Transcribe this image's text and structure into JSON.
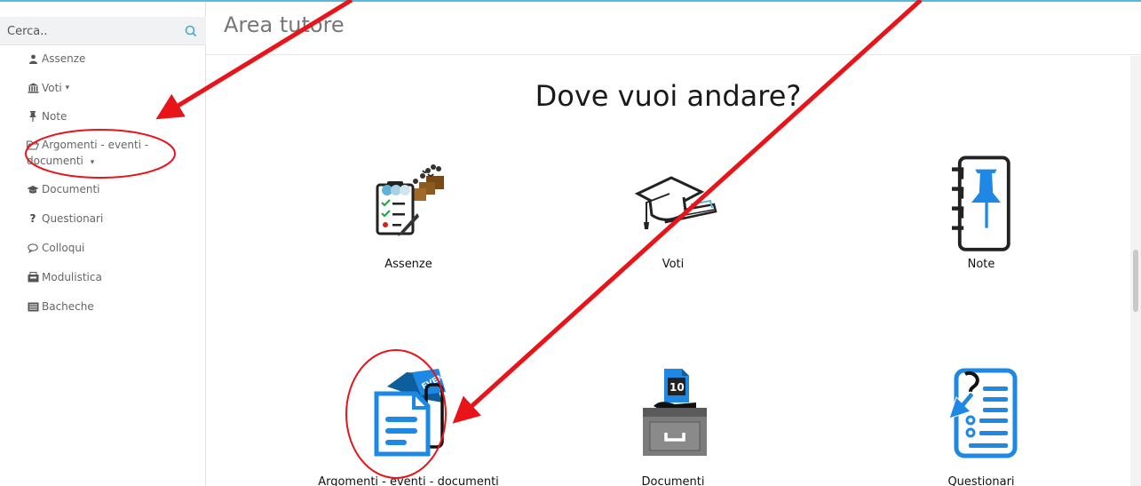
{
  "search": {
    "placeholder": "Cerca.."
  },
  "sidebar": {
    "items": [
      {
        "label": "Assenze",
        "icon": "user-icon"
      },
      {
        "label": "Voti",
        "icon": "bank-icon",
        "caret": "▾"
      },
      {
        "label": "Note",
        "icon": "pin-icon"
      },
      {
        "label": "Argomenti - eventi - documenti",
        "icon": "folder-open-icon",
        "caret": "▾"
      },
      {
        "label": "Documenti",
        "icon": "graduation-cap-icon"
      },
      {
        "label": "Questionari",
        "icon": "question-icon"
      },
      {
        "label": "Colloqui",
        "icon": "chat-icon"
      },
      {
        "label": "Modulistica",
        "icon": "document-stack-icon"
      },
      {
        "label": "Bacheche",
        "icon": "board-icon"
      }
    ]
  },
  "header": {
    "title": "Area tutore"
  },
  "main": {
    "question": "Dove vuoi andare?",
    "tiles": [
      {
        "label": "Assenze",
        "icon": "attendance-clipboard-icon"
      },
      {
        "label": "Voti",
        "icon": "graduation-cap-diploma-icon"
      },
      {
        "label": "Note",
        "icon": "notebook-pin-icon"
      },
      {
        "label": "Argomenti - eventi - documenti",
        "icon": "event-document-icon"
      },
      {
        "label": "Documenti",
        "icon": "document-drawer-icon"
      },
      {
        "label": "Questionari",
        "icon": "questionnaire-icon"
      }
    ]
  },
  "colors": {
    "accent": "#5ab7d6",
    "annotation": "#e8141a",
    "tile_blue": "#1e88e5"
  }
}
